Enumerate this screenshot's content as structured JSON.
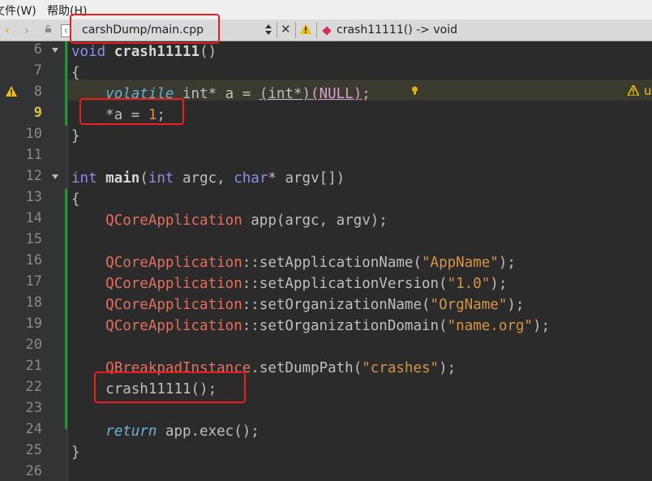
{
  "menubar": {
    "file_menu": "文件(W)",
    "help_menu": "帮助(H)"
  },
  "toolbar": {
    "back_glyph": "‹",
    "forward_glyph": "›",
    "file_icon_text": "c",
    "file_name": "carshDump/main.cpp",
    "close_glyph": "✕",
    "symbol": "crash11111() -> void"
  },
  "gutter": {
    "line_numbers": [
      "6",
      "7",
      "8",
      "9",
      "10",
      "11",
      "12",
      "13",
      "14",
      "15",
      "16",
      "17",
      "18",
      "19",
      "20",
      "21",
      "22",
      "23",
      "24",
      "25",
      "26"
    ],
    "current_line": "9"
  },
  "warning": {
    "text": "u"
  },
  "code": {
    "l6_kw": "void",
    "l6_fn": "crash11111",
    "l6_rest": "()",
    "l7": "{",
    "l8_volatile": "volatile",
    "l8_a": " int* a = ",
    "l8_cast": "(int*)",
    "l8_null": "(NULL)",
    "l8_end": ";",
    "l9_a": "    *a = ",
    "l9_num": "1",
    "l9_end": ";",
    "l10": "}",
    "l12_int": "int",
    "l12_main": "main",
    "l12_b": "(",
    "l12_int2": "int",
    "l12_c": " argc, ",
    "l12_char": "char",
    "l12_d": "* argv[])",
    "l13": "{",
    "l14_cls": "QCoreApplication",
    "l14_rest": " app(argc, argv);",
    "l16_cls": "QCoreApplication",
    "l16_m": "::setApplicationName(",
    "l16_s": "\"AppName\"",
    "l16_e": ");",
    "l17_cls": "QCoreApplication",
    "l17_m": "::setApplicationVersion(",
    "l17_s": "\"1.0\"",
    "l17_e": ");",
    "l18_cls": "QCoreApplication",
    "l18_m": "::setOrganizationName(",
    "l18_s": "\"OrgName\"",
    "l18_e": ");",
    "l19_cls": "QCoreApplication",
    "l19_m": "::setOrganizationDomain(",
    "l19_s": "\"name.org\"",
    "l19_e": ");",
    "l21_cls": "QBreakpadInstance",
    "l21_m": ".setDumpPath(",
    "l21_s": "\"crashes\"",
    "l21_e": ");",
    "l22": "crash11111();",
    "l24_kw": "return",
    "l24_rest": " app.exec();",
    "l25": "}"
  },
  "colors": {
    "highlight_box": "#ee1c1c",
    "keyword": "#8d8df0",
    "class_name": "#e56f5c",
    "string": "#d69545",
    "warning": "#f0c000"
  }
}
